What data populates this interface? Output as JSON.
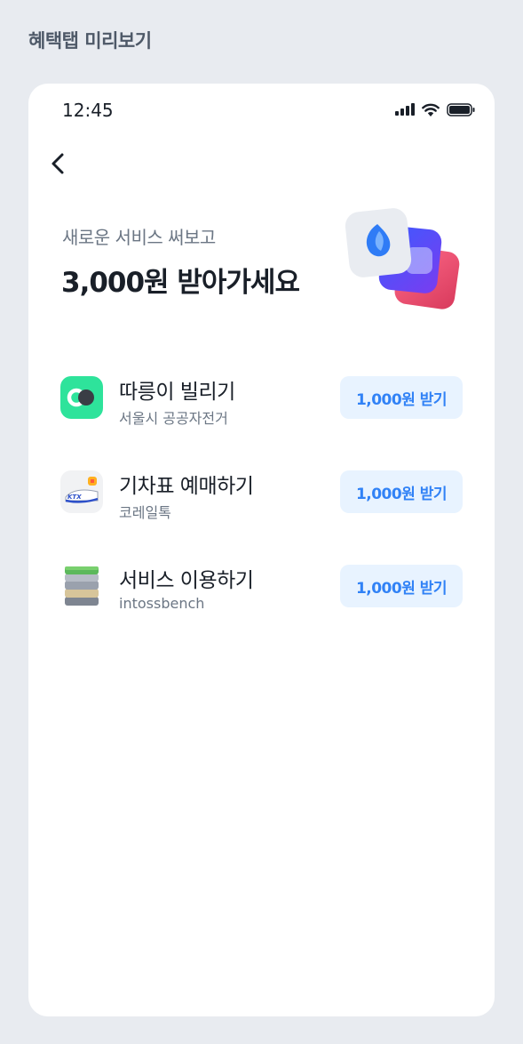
{
  "page": {
    "title": "혜택탭 미리보기"
  },
  "status_bar": {
    "time": "12:45",
    "icons": [
      "signal-icon",
      "wifi-icon",
      "battery-icon"
    ]
  },
  "header": {
    "back_icon": "chevron-left-icon"
  },
  "hero": {
    "subtitle": "새로운 서비스 써보고",
    "title": "3,000원 받아가세요",
    "art": "stacked-app-icons-illustration"
  },
  "items": [
    {
      "title": "따릉이 빌리기",
      "subtitle": "서울시 공공자전거",
      "button": "1,000원 받기",
      "icon": "ddareungi-icon"
    },
    {
      "title": "기차표 예매하기",
      "subtitle": "코레일톡",
      "button": "1,000원 받기",
      "icon": "korail-talk-icon"
    },
    {
      "title": "서비스 이용하기",
      "subtitle": "intossbench",
      "button": "1,000원 받기",
      "icon": "stack-layers-icon"
    }
  ],
  "colors": {
    "background": "#e8ebf0",
    "card": "#ffffff",
    "accent": "#3182f6",
    "accent_bg": "#e8f3ff",
    "text_primary": "#191f28",
    "text_secondary": "#6b7684",
    "ddareungi_green": "#2ee39b"
  }
}
